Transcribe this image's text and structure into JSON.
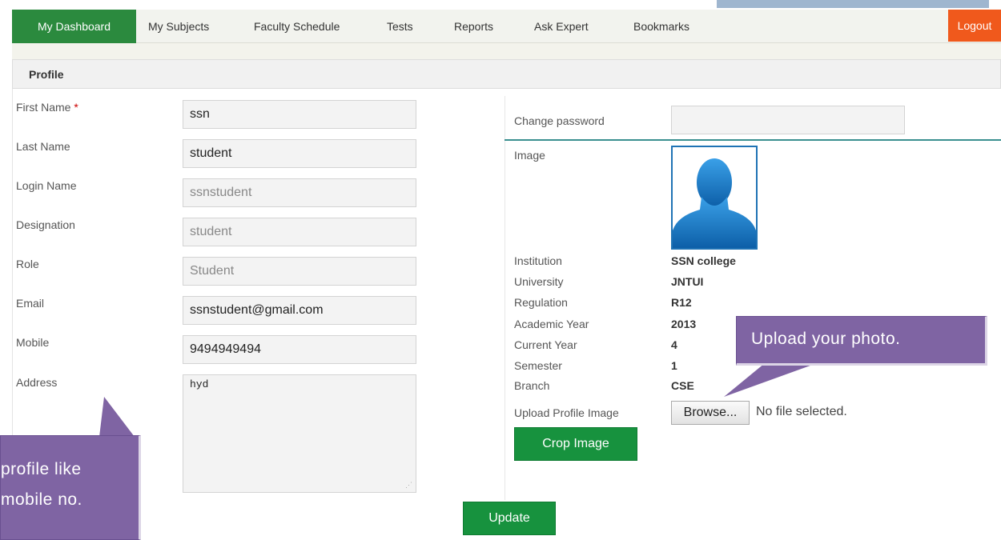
{
  "nav": {
    "items": [
      "My Dashboard",
      "My Subjects",
      "Faculty Schedule",
      "Tests",
      "Reports",
      "Ask Expert",
      "Bookmarks"
    ],
    "logout": "Logout"
  },
  "panel": {
    "title": "Profile"
  },
  "form": {
    "first_name": {
      "label": "First Name",
      "required_mark": "*",
      "value": "ssn"
    },
    "last_name": {
      "label": "Last Name",
      "value": "student"
    },
    "login_name": {
      "label": "Login Name",
      "value": "ssnstudent"
    },
    "designation": {
      "label": "Designation",
      "value": "student"
    },
    "role": {
      "label": "Role",
      "value": "Student"
    },
    "email": {
      "label": "Email",
      "value": "ssnstudent@gmail.com"
    },
    "mobile": {
      "label": "Mobile",
      "value": "9494949494"
    },
    "address": {
      "label": "Address",
      "value": "hyd"
    }
  },
  "right": {
    "change_password": {
      "label": "Change password",
      "value": ""
    },
    "image_label": "Image",
    "info": [
      {
        "label": "Institution",
        "value": "SSN college"
      },
      {
        "label": "University",
        "value": "JNTUI"
      },
      {
        "label": "Regulation",
        "value": "R12"
      },
      {
        "label": "Academic Year",
        "value": "2013"
      },
      {
        "label": "Current Year",
        "value": "4"
      },
      {
        "label": "Semester",
        "value": "1"
      },
      {
        "label": "Branch",
        "value": "CSE"
      }
    ],
    "upload_label": "Upload Profile Image",
    "browse_label": "Browse...",
    "no_file_text": "No file selected.",
    "crop_label": "Crop Image"
  },
  "update_label": "Update",
  "callouts": {
    "right_text": "Upload your photo.",
    "left_line1": "profile like",
    "left_line2": "mobile no."
  },
  "colors": {
    "nav_active": "#2b8a3e",
    "logout": "#f0591c",
    "button_green": "#17923e",
    "callout": "#7f64a3"
  }
}
